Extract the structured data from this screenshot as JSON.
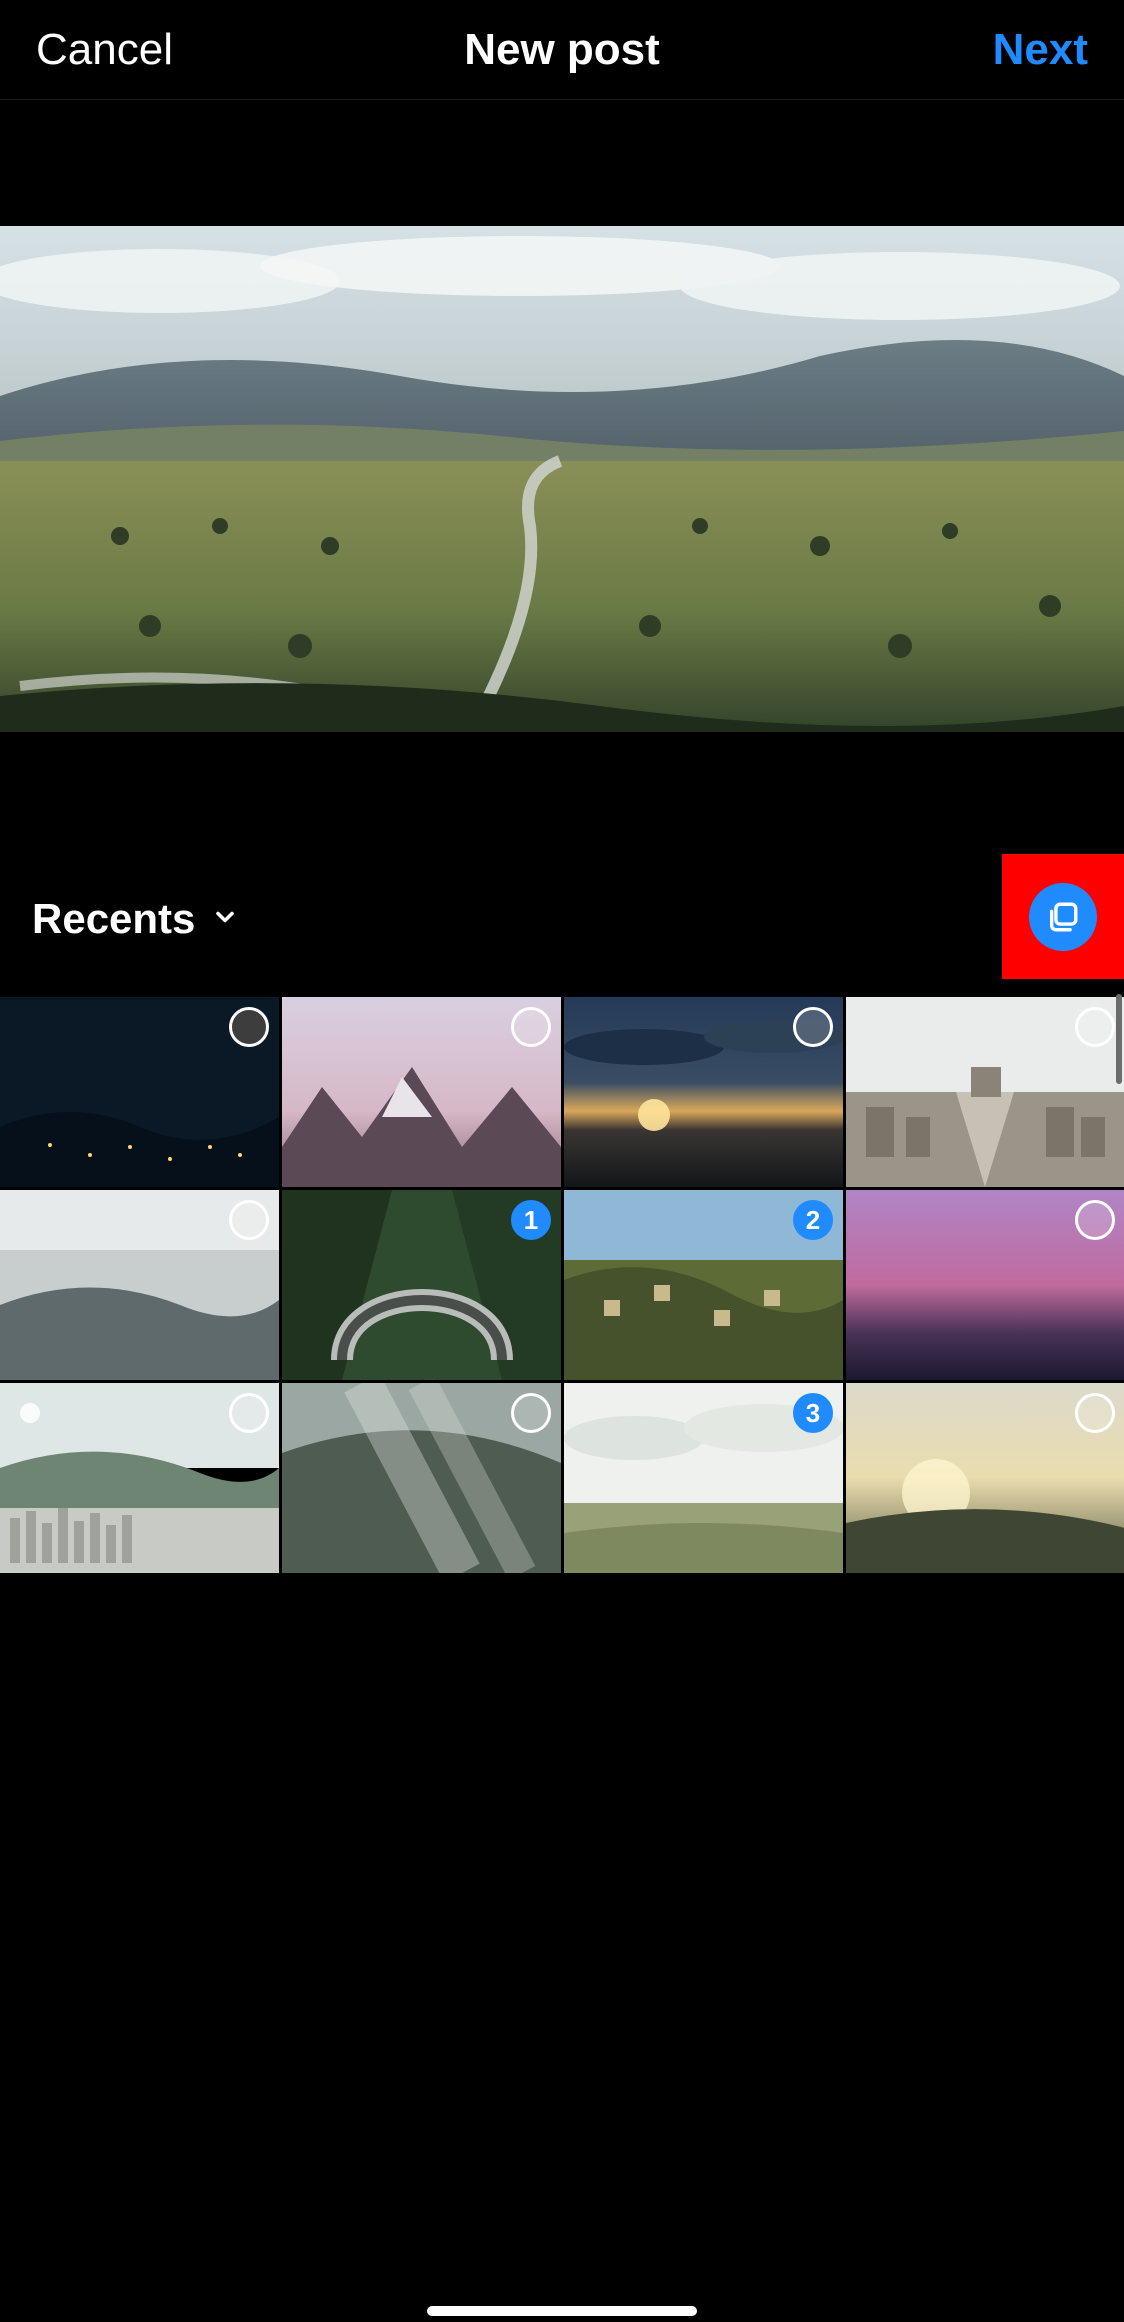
{
  "header": {
    "cancel": "Cancel",
    "title": "New post",
    "next": "Next"
  },
  "album": {
    "label": "Recents"
  },
  "colors": {
    "accent": "#1f8bff",
    "highlight": "#ff0000"
  },
  "thumbs": [
    {
      "selected": false,
      "order": null,
      "darkFill": true,
      "desc": "night-bay-city"
    },
    {
      "selected": false,
      "order": null,
      "darkFill": false,
      "desc": "pink-mountains-dawn"
    },
    {
      "selected": false,
      "order": null,
      "darkFill": false,
      "desc": "sunset-clouds-town"
    },
    {
      "selected": false,
      "order": null,
      "darkFill": false,
      "desc": "paris-boulevard"
    },
    {
      "selected": false,
      "order": null,
      "darkFill": false,
      "desc": "grey-glacier"
    },
    {
      "selected": true,
      "order": "1",
      "darkFill": false,
      "desc": "hairpin-road"
    },
    {
      "selected": true,
      "order": "2",
      "darkFill": false,
      "desc": "hill-village"
    },
    {
      "selected": false,
      "order": null,
      "darkFill": false,
      "desc": "purple-city-dusk"
    },
    {
      "selected": false,
      "order": null,
      "darkFill": false,
      "desc": "dense-city-hills"
    },
    {
      "selected": false,
      "order": null,
      "darkFill": false,
      "desc": "sunrays-valley"
    },
    {
      "selected": true,
      "order": "3",
      "darkFill": false,
      "desc": "flat-farm-clouds"
    },
    {
      "selected": false,
      "order": null,
      "darkFill": false,
      "desc": "sunrise-town-aerial"
    }
  ]
}
